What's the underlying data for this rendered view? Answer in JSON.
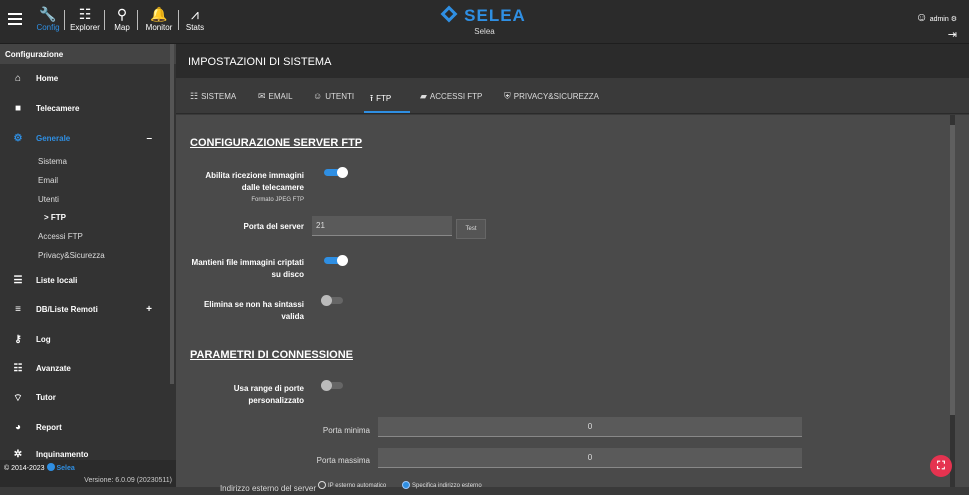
{
  "topnav": {
    "items": [
      {
        "label": "Config",
        "icon": "wrench-icon"
      },
      {
        "label": "Explorer",
        "icon": "explorer-icon"
      },
      {
        "label": "Map",
        "icon": "map-pin-icon"
      },
      {
        "label": "Monitor",
        "icon": "bell-icon"
      },
      {
        "label": "Stats",
        "icon": "stats-icon"
      }
    ],
    "brand": "SELEA",
    "brand_sub": "Selea",
    "user": "admin",
    "accent": "#2f8fe3"
  },
  "sidebar": {
    "header": "Configurazione",
    "items": [
      {
        "label": "Home",
        "icon": "home-icon"
      },
      {
        "label": "Telecamere",
        "icon": "camera-icon"
      },
      {
        "label": "Generale",
        "icon": "gear-icon",
        "action": "–"
      },
      {
        "label": "Liste locali",
        "icon": "list-icon"
      },
      {
        "label": "DB/Liste Remoti",
        "icon": "database-icon",
        "action": "+"
      },
      {
        "label": "Log",
        "icon": "key-icon"
      },
      {
        "label": "Avanzate",
        "icon": "sliders-icon"
      },
      {
        "label": "Tutor",
        "icon": "signal-icon"
      },
      {
        "label": "Report",
        "icon": "pie-icon"
      },
      {
        "label": "Inquinamento",
        "icon": "atom-icon"
      }
    ],
    "subitems": [
      "Sistema",
      "Email",
      "Utenti",
      "> FTP",
      "Accessi FTP",
      "Privacy&Sicurezza"
    ],
    "footer_copy": "© 2014-2023",
    "footer_brand": "Selea",
    "version": "Versione: 6.0.09 (20230511)"
  },
  "main": {
    "title": "IMPOSTAZIONI DI SISTEMA",
    "tabs": [
      {
        "label": "SISTEMA",
        "icon": "sliders-icon"
      },
      {
        "label": "EMAIL",
        "icon": "mail-icon"
      },
      {
        "label": "UTENTI",
        "icon": "user-icon"
      },
      {
        "label": "FTP",
        "icon": "upload-icon"
      },
      {
        "label": "ACCESSI FTP",
        "icon": "folder-icon"
      },
      {
        "label": "PRIVACY&SICUREZZA",
        "icon": "shield-icon"
      }
    ],
    "active_tab": "FTP",
    "sections": {
      "ftp_server": "CONFIGURAZIONE SERVER FTP",
      "connection": "PARAMETRI DI CONNESSIONE"
    },
    "fields": {
      "enable_label_1": "Abilita ricezione immagini",
      "enable_label_2": "dalle telecamere",
      "enable_hint": "Formato JPEG FTP",
      "enable_value": true,
      "port_label": "Porta del server",
      "port_value": "21",
      "test_label": "Test",
      "keep_label_1": "Mantieni file immagini criptati",
      "keep_label_2": "su disco",
      "keep_value": true,
      "delete_label_1": "Elimina se non ha sintassi",
      "delete_label_2": "valida",
      "delete_value": false,
      "range_label_1": "Usa range di porte",
      "range_label_2": "personalizzato",
      "range_value": false,
      "min_port_label": "Porta minima",
      "min_port_value": "0",
      "max_port_label": "Porta massima",
      "max_port_value": "0",
      "ext_ip_label": "Indirizzo esterno del server",
      "ext_ip_opt1": "IP esterno automatico",
      "ext_ip_opt2": "Specifica indirizzo esterno",
      "ext_ip_selected": "Specifica indirizzo esterno"
    }
  }
}
